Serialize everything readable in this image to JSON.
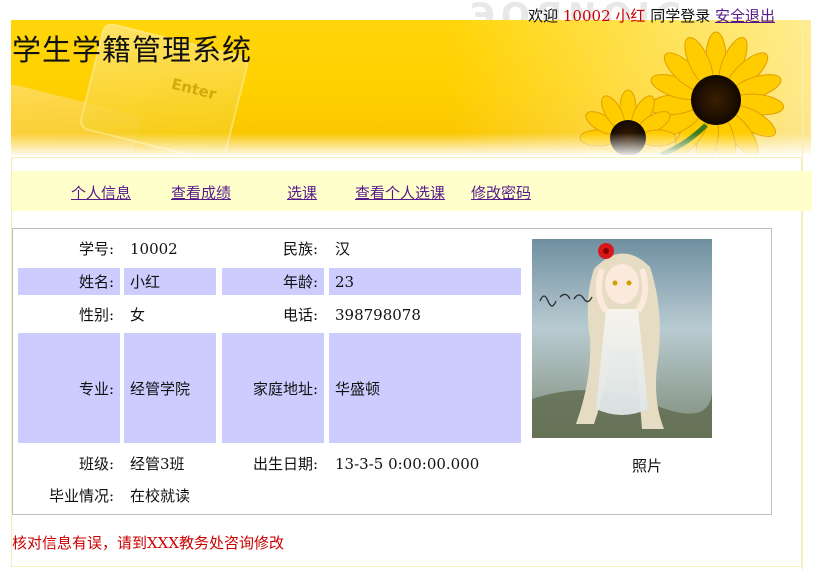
{
  "header": {
    "title": "学生学籍管理系统",
    "welcome": "欢迎",
    "student_id": "10002",
    "student_name": "小红",
    "login_suffix": "同学登录",
    "logout_label": "安全退出"
  },
  "nav": {
    "items": [
      "个人信息",
      "查看成绩",
      "选课",
      "查看个人选课",
      "修改密码"
    ]
  },
  "info": {
    "rows": [
      {
        "l1": "学号:",
        "v1": "10002",
        "l2": "民族:",
        "v2": "汉"
      },
      {
        "l1": "姓名:",
        "v1": "小红",
        "l2": "年龄:",
        "v2": "23"
      },
      {
        "l1": "性别:",
        "v1": "女",
        "l2": "电话:",
        "v2": "398798078"
      },
      {
        "l1": "专业:",
        "v1": "经管学院",
        "l2": "家庭地址:",
        "v2": "华盛顿"
      },
      {
        "l1": "班级:",
        "v1": "经管3班",
        "l2": "出生日期:",
        "v2": "13-3-5 0:00:00.000"
      },
      {
        "l1": "毕业情况:",
        "v1": "在校就读"
      }
    ],
    "photo_caption": "照片"
  },
  "note": "核对信息有误，请到XXX教务处咨询修改",
  "colors": {
    "banner": "#ffd60a",
    "nav_bg": "#ffffcc",
    "row_shade": "#ccccff",
    "alert_red": "#cc0000",
    "link": "#551a8b"
  }
}
